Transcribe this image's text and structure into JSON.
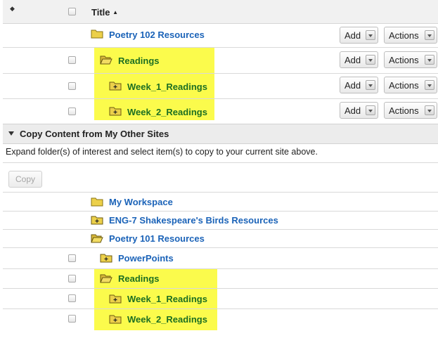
{
  "header": {
    "sort_icon": "sort-arrows-icon",
    "title": "Title",
    "title_sort": "▲"
  },
  "top_rows": [
    {
      "name": "Poetry 102 Resources",
      "add": "Add",
      "actions": "Actions"
    },
    {
      "name": "Readings",
      "add": "Add",
      "actions": "Actions"
    },
    {
      "name": "Week_1_Readings",
      "add": "Add",
      "actions": "Actions"
    },
    {
      "name": "Week_2_Readings",
      "add": "Add",
      "actions": "Actions"
    }
  ],
  "copy_section": {
    "title": "Copy Content from My Other Sites",
    "instructions": "Expand folder(s) of interest and select item(s) to copy to your current site above.",
    "copy_button": "Copy",
    "items": [
      {
        "name": "My Workspace"
      },
      {
        "name": "ENG-7 Shakespeare's Birds Resources"
      },
      {
        "name": "Poetry 101 Resources"
      },
      {
        "name": "PowerPoints"
      },
      {
        "name": "Readings"
      },
      {
        "name": "Week_1_Readings"
      },
      {
        "name": "Week_2_Readings"
      }
    ]
  },
  "colors": {
    "link": "#1b63b8",
    "highlight_text": "#1d6f22",
    "highlight_bg": "#fbfb4c"
  }
}
